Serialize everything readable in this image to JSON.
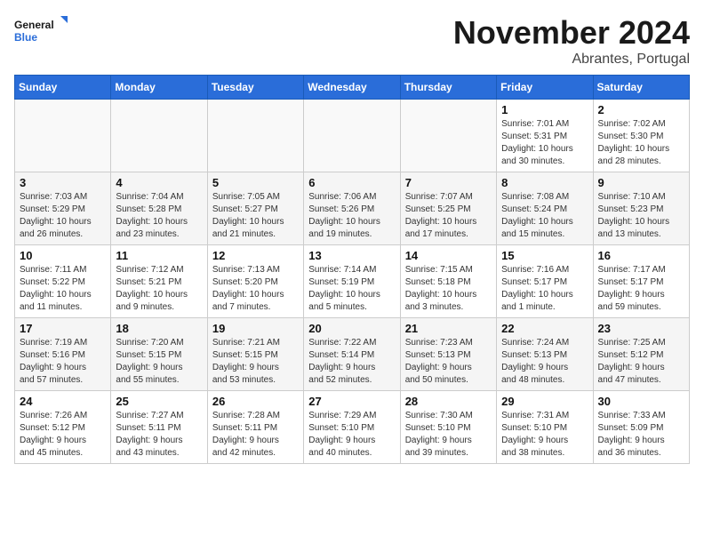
{
  "header": {
    "logo_general": "General",
    "logo_blue": "Blue",
    "month_title": "November 2024",
    "location": "Abrantes, Portugal"
  },
  "days_of_week": [
    "Sunday",
    "Monday",
    "Tuesday",
    "Wednesday",
    "Thursday",
    "Friday",
    "Saturday"
  ],
  "weeks": [
    [
      {
        "day": "",
        "info": ""
      },
      {
        "day": "",
        "info": ""
      },
      {
        "day": "",
        "info": ""
      },
      {
        "day": "",
        "info": ""
      },
      {
        "day": "",
        "info": ""
      },
      {
        "day": "1",
        "info": "Sunrise: 7:01 AM\nSunset: 5:31 PM\nDaylight: 10 hours\nand 30 minutes."
      },
      {
        "day": "2",
        "info": "Sunrise: 7:02 AM\nSunset: 5:30 PM\nDaylight: 10 hours\nand 28 minutes."
      }
    ],
    [
      {
        "day": "3",
        "info": "Sunrise: 7:03 AM\nSunset: 5:29 PM\nDaylight: 10 hours\nand 26 minutes."
      },
      {
        "day": "4",
        "info": "Sunrise: 7:04 AM\nSunset: 5:28 PM\nDaylight: 10 hours\nand 23 minutes."
      },
      {
        "day": "5",
        "info": "Sunrise: 7:05 AM\nSunset: 5:27 PM\nDaylight: 10 hours\nand 21 minutes."
      },
      {
        "day": "6",
        "info": "Sunrise: 7:06 AM\nSunset: 5:26 PM\nDaylight: 10 hours\nand 19 minutes."
      },
      {
        "day": "7",
        "info": "Sunrise: 7:07 AM\nSunset: 5:25 PM\nDaylight: 10 hours\nand 17 minutes."
      },
      {
        "day": "8",
        "info": "Sunrise: 7:08 AM\nSunset: 5:24 PM\nDaylight: 10 hours\nand 15 minutes."
      },
      {
        "day": "9",
        "info": "Sunrise: 7:10 AM\nSunset: 5:23 PM\nDaylight: 10 hours\nand 13 minutes."
      }
    ],
    [
      {
        "day": "10",
        "info": "Sunrise: 7:11 AM\nSunset: 5:22 PM\nDaylight: 10 hours\nand 11 minutes."
      },
      {
        "day": "11",
        "info": "Sunrise: 7:12 AM\nSunset: 5:21 PM\nDaylight: 10 hours\nand 9 minutes."
      },
      {
        "day": "12",
        "info": "Sunrise: 7:13 AM\nSunset: 5:20 PM\nDaylight: 10 hours\nand 7 minutes."
      },
      {
        "day": "13",
        "info": "Sunrise: 7:14 AM\nSunset: 5:19 PM\nDaylight: 10 hours\nand 5 minutes."
      },
      {
        "day": "14",
        "info": "Sunrise: 7:15 AM\nSunset: 5:18 PM\nDaylight: 10 hours\nand 3 minutes."
      },
      {
        "day": "15",
        "info": "Sunrise: 7:16 AM\nSunset: 5:17 PM\nDaylight: 10 hours\nand 1 minute."
      },
      {
        "day": "16",
        "info": "Sunrise: 7:17 AM\nSunset: 5:17 PM\nDaylight: 9 hours\nand 59 minutes."
      }
    ],
    [
      {
        "day": "17",
        "info": "Sunrise: 7:19 AM\nSunset: 5:16 PM\nDaylight: 9 hours\nand 57 minutes."
      },
      {
        "day": "18",
        "info": "Sunrise: 7:20 AM\nSunset: 5:15 PM\nDaylight: 9 hours\nand 55 minutes."
      },
      {
        "day": "19",
        "info": "Sunrise: 7:21 AM\nSunset: 5:15 PM\nDaylight: 9 hours\nand 53 minutes."
      },
      {
        "day": "20",
        "info": "Sunrise: 7:22 AM\nSunset: 5:14 PM\nDaylight: 9 hours\nand 52 minutes."
      },
      {
        "day": "21",
        "info": "Sunrise: 7:23 AM\nSunset: 5:13 PM\nDaylight: 9 hours\nand 50 minutes."
      },
      {
        "day": "22",
        "info": "Sunrise: 7:24 AM\nSunset: 5:13 PM\nDaylight: 9 hours\nand 48 minutes."
      },
      {
        "day": "23",
        "info": "Sunrise: 7:25 AM\nSunset: 5:12 PM\nDaylight: 9 hours\nand 47 minutes."
      }
    ],
    [
      {
        "day": "24",
        "info": "Sunrise: 7:26 AM\nSunset: 5:12 PM\nDaylight: 9 hours\nand 45 minutes."
      },
      {
        "day": "25",
        "info": "Sunrise: 7:27 AM\nSunset: 5:11 PM\nDaylight: 9 hours\nand 43 minutes."
      },
      {
        "day": "26",
        "info": "Sunrise: 7:28 AM\nSunset: 5:11 PM\nDaylight: 9 hours\nand 42 minutes."
      },
      {
        "day": "27",
        "info": "Sunrise: 7:29 AM\nSunset: 5:10 PM\nDaylight: 9 hours\nand 40 minutes."
      },
      {
        "day": "28",
        "info": "Sunrise: 7:30 AM\nSunset: 5:10 PM\nDaylight: 9 hours\nand 39 minutes."
      },
      {
        "day": "29",
        "info": "Sunrise: 7:31 AM\nSunset: 5:10 PM\nDaylight: 9 hours\nand 38 minutes."
      },
      {
        "day": "30",
        "info": "Sunrise: 7:33 AM\nSunset: 5:09 PM\nDaylight: 9 hours\nand 36 minutes."
      }
    ]
  ]
}
